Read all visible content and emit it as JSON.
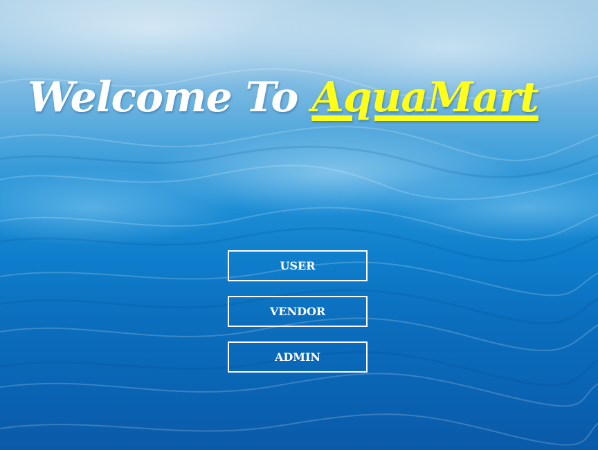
{
  "header": {
    "welcome_text": "Welcome To",
    "brand_name": "AquaMart",
    "brand_color": "#ffff1a",
    "welcome_color": "#ffffff"
  },
  "menu": {
    "buttons": [
      {
        "label": "USER"
      },
      {
        "label": "VENDOR"
      },
      {
        "label": "ADMIN"
      }
    ]
  },
  "background": {
    "description_icon": "underwater-water-surface-image"
  }
}
